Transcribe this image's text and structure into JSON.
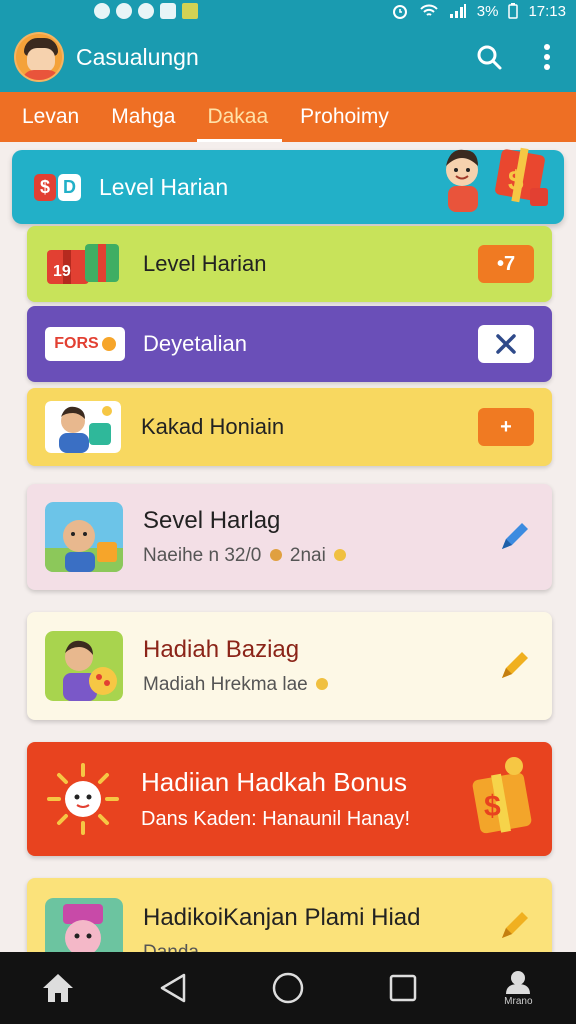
{
  "status_bar": {
    "battery": "3%",
    "time": "17:13"
  },
  "app_bar": {
    "title": "Casualungn"
  },
  "tabs": [
    {
      "label": "Levan",
      "active": false
    },
    {
      "label": "Mahga",
      "active": false
    },
    {
      "label": "Dakaa",
      "active": true
    },
    {
      "label": "Prohoimy",
      "active": false
    }
  ],
  "header_card": {
    "badge_left": "$",
    "badge_right": "D",
    "title": "Level Harian"
  },
  "rows": [
    {
      "title": "Level Harian",
      "action": "•7",
      "bg": "#c8e35a",
      "action_bg": "#f07a22"
    },
    {
      "title": "Deyetalian",
      "badge": "FORS",
      "action": "✕",
      "bg": "#6a4fb8",
      "action_bg": "#ffffff"
    },
    {
      "title": "Kakad Honiain",
      "action": "+",
      "bg": "#f8d860",
      "action_bg": "#f07a22"
    }
  ],
  "cards": [
    {
      "title": "Sevel Harlag",
      "subtitle": "Naeihe n 32/0",
      "subtitle_extra": "2nai",
      "bg": "#f3dfe6",
      "title_color": "#222222",
      "icon_color": "#3c8be0"
    },
    {
      "title": "Hadiah Baziag",
      "subtitle": "Madiah Hrekma lae",
      "bg": "#fdf8e6",
      "title_color": "#8b2418",
      "icon_color": "#f0b020"
    },
    {
      "title": "Hadiian Hadkah Bonus",
      "subtitle": "Dans Kaden: Hanaunil Hanay!",
      "bg": "#e8431f",
      "title_color": "#ffffff",
      "icon_color": "#f3c530"
    },
    {
      "title": "HadikoiKanjan Plami Hiad",
      "subtitle": "Danda...",
      "bg": "#fbe27a",
      "title_color": "#222222",
      "icon_color": "#f0b020"
    }
  ],
  "nav_bar": {
    "profile_label": "Mrano"
  }
}
